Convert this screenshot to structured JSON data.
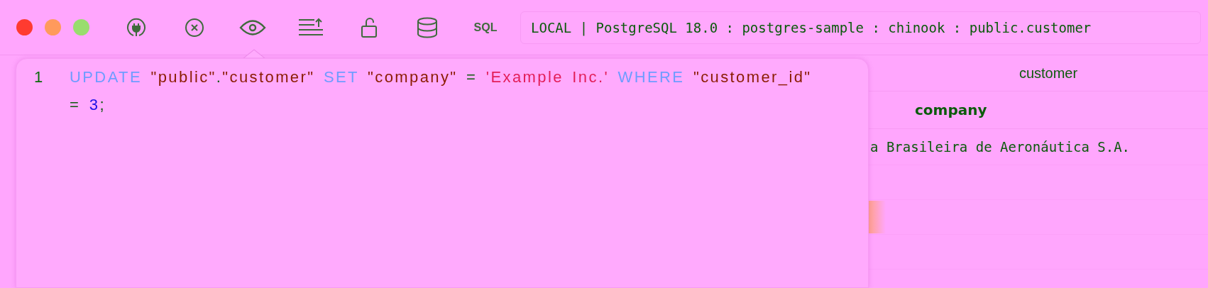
{
  "window": {
    "controls": [
      {
        "color": "#ff3b30"
      },
      {
        "color": "#ff9a5c"
      },
      {
        "color": "#99dd6e"
      }
    ]
  },
  "toolbar": {
    "items": [
      {
        "kind": "plug"
      },
      {
        "kind": "stop"
      },
      {
        "kind": "eye"
      },
      {
        "kind": "upload"
      },
      {
        "kind": "lock"
      },
      {
        "kind": "database"
      },
      {
        "kind": "sql",
        "label": "SQL"
      }
    ],
    "connection": "LOCAL | PostgreSQL 18.0 : postgres-sample : chinook : public.customer"
  },
  "preview": {
    "line_number": "1",
    "rows": [
      {
        "tokens": [
          {
            "kind": "keyword",
            "text": "UPDATE "
          },
          {
            "kind": "identifier",
            "text": "\"public\""
          },
          {
            "kind": "operator",
            "text": "."
          },
          {
            "kind": "identifier",
            "text": "\"customer\" "
          },
          {
            "kind": "keyword",
            "text": "SET "
          },
          {
            "kind": "identifier",
            "text": "\"company\" "
          },
          {
            "kind": "operator",
            "text": "= "
          },
          {
            "kind": "string",
            "text": "'Example Inc.' "
          },
          {
            "kind": "keyword",
            "text": "WHERE "
          },
          {
            "kind": "identifier",
            "text": "\"customer_id\""
          }
        ]
      },
      {
        "tokens": [
          {
            "kind": "operator",
            "text": "= "
          },
          {
            "kind": "number",
            "text": "3"
          },
          {
            "kind": "operator",
            "text": ";"
          }
        ]
      }
    ]
  },
  "table": {
    "title": "customer",
    "columns": [
      "company"
    ],
    "rows": [
      [
        "a Brasileira de Aeronáutica S.A."
      ]
    ]
  }
}
